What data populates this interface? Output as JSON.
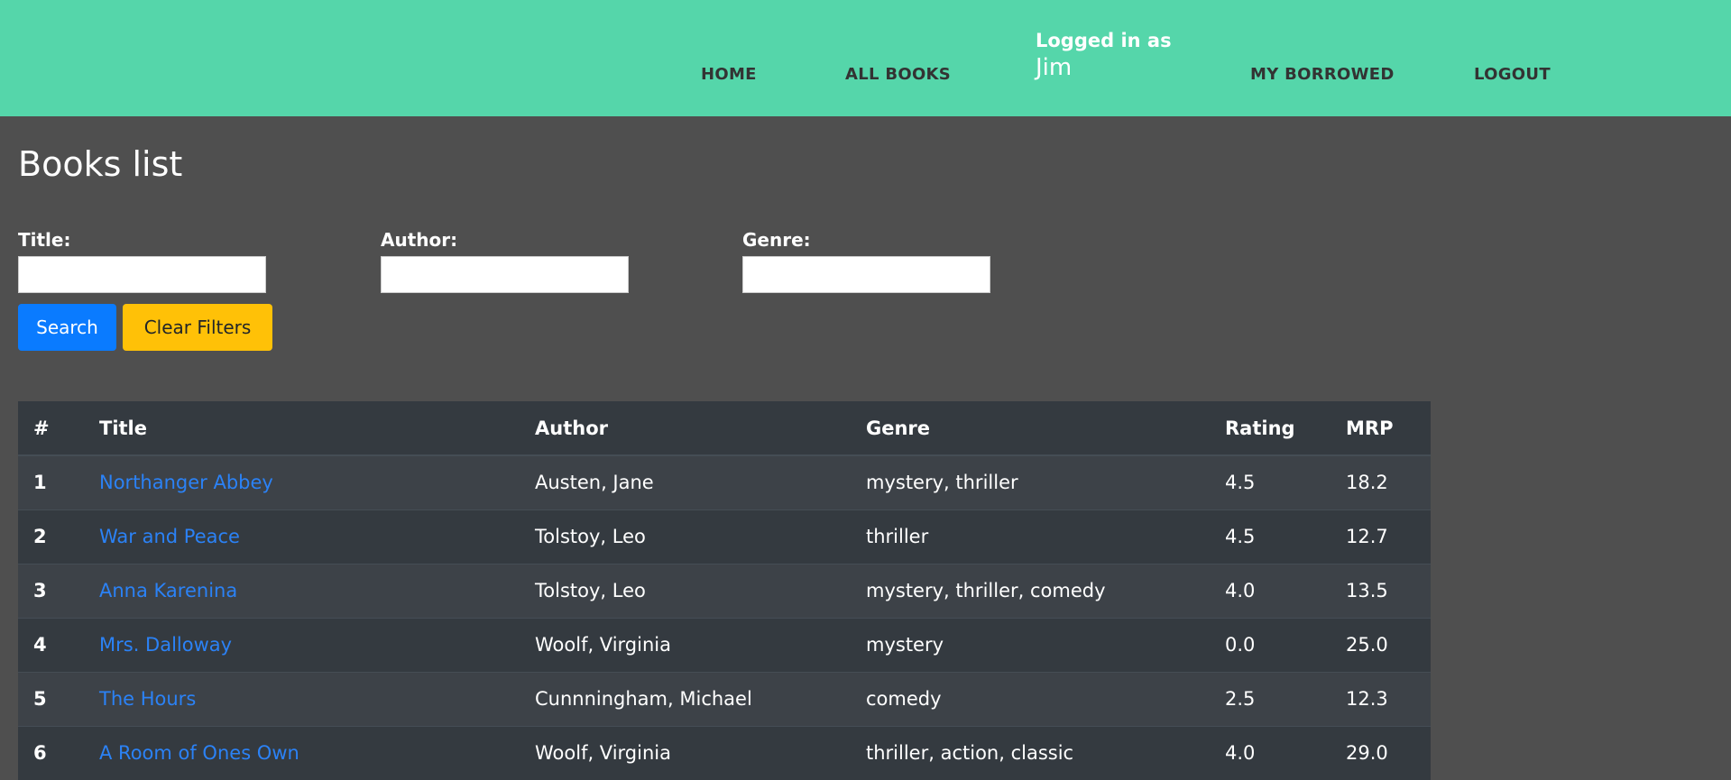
{
  "nav": {
    "home": "HOME",
    "all_books": "ALL BOOKS",
    "logged_in_label": "Logged in as",
    "user_name": "Jim",
    "my_borrowed": "MY BORROWED",
    "logout": "LOGOUT"
  },
  "colors": {
    "header_bg": "#55d6aa",
    "page_bg": "#4f4f4f",
    "search_button": "#0a7bff",
    "clear_button": "#ffc107",
    "link": "#2b82f6"
  },
  "page": {
    "title": "Books list"
  },
  "filters": {
    "title_label": "Title:",
    "title_value": "",
    "author_label": "Author:",
    "author_value": "",
    "genre_label": "Genre:",
    "genre_value": "",
    "search_label": "Search",
    "clear_label": "Clear Filters"
  },
  "table": {
    "headers": [
      "#",
      "Title",
      "Author",
      "Genre",
      "Rating",
      "MRP"
    ],
    "rows": [
      {
        "num": "1",
        "title": "Northanger Abbey",
        "author": "Austen, Jane",
        "genre": "mystery, thriller",
        "rating": "4.5",
        "mrp": "18.2"
      },
      {
        "num": "2",
        "title": "War and Peace",
        "author": "Tolstoy, Leo",
        "genre": "thriller",
        "rating": "4.5",
        "mrp": "12.7"
      },
      {
        "num": "3",
        "title": "Anna Karenina",
        "author": "Tolstoy, Leo",
        "genre": "mystery, thriller, comedy",
        "rating": "4.0",
        "mrp": "13.5"
      },
      {
        "num": "4",
        "title": "Mrs. Dalloway",
        "author": "Woolf, Virginia",
        "genre": "mystery",
        "rating": "0.0",
        "mrp": "25.0"
      },
      {
        "num": "5",
        "title": "The Hours",
        "author": "Cunnningham, Michael",
        "genre": "comedy",
        "rating": "2.5",
        "mrp": "12.3"
      },
      {
        "num": "6",
        "title": "A Room of Ones Own",
        "author": "Woolf, Virginia",
        "genre": "thriller, action, classic",
        "rating": "4.0",
        "mrp": "29.0"
      }
    ]
  }
}
